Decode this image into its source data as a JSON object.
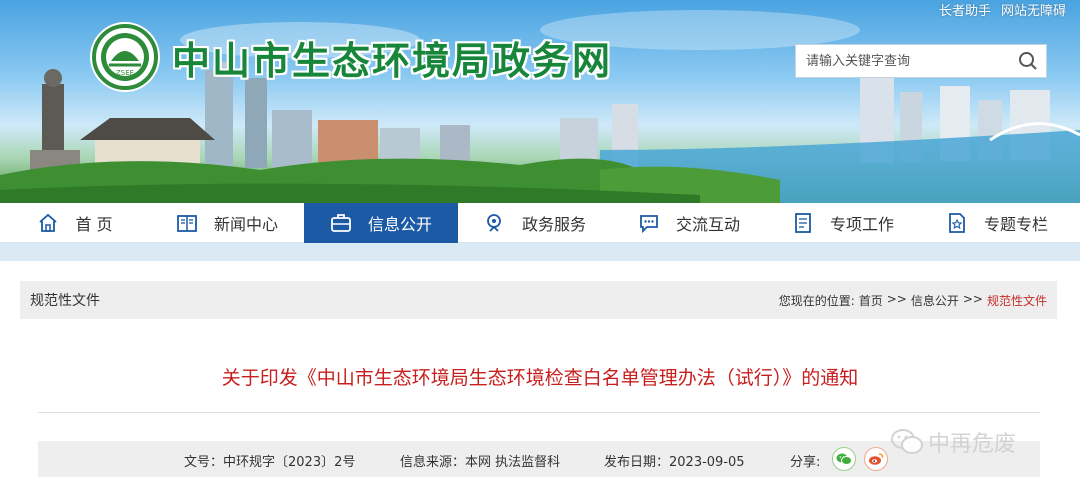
{
  "top_links": [
    "长者助手",
    "网站无障碍"
  ],
  "header": {
    "site_title": "中山市生态环境局政务网",
    "logo_text": "ZSEE",
    "search_placeholder": "请输入关键字查询"
  },
  "nav": [
    {
      "label": "首 页",
      "icon": "home-icon"
    },
    {
      "label": "新闻中心",
      "icon": "news-icon"
    },
    {
      "label": "信息公开",
      "icon": "briefcase-icon",
      "active": true
    },
    {
      "label": "政务服务",
      "icon": "service-icon"
    },
    {
      "label": "交流互动",
      "icon": "chat-icon"
    },
    {
      "label": "专项工作",
      "icon": "document-icon"
    },
    {
      "label": "专题专栏",
      "icon": "star-page-icon"
    }
  ],
  "colors": {
    "nav_active": "#1c5aa6",
    "title_red": "#c81e1e",
    "logo_green": "#17863a"
  },
  "breadcrumb": {
    "section_title": "规范性文件",
    "prefix": "您现在的位置:",
    "items": [
      "首页",
      "信息公开",
      "规范性文件"
    ],
    "separator": ">>"
  },
  "article": {
    "title": "关于印发《中山市生态环境局生态环境检查白名单管理办法（试行）》的通知",
    "doc_number": "文号：中环规字〔2023〕2号",
    "source": "信息来源：本网 执法监督科",
    "publish_date": "发布日期：2023-09-05",
    "share_label": "分享:"
  },
  "share_icons": [
    "wechat-icon",
    "weibo-icon"
  ],
  "watermark": "中再危废"
}
